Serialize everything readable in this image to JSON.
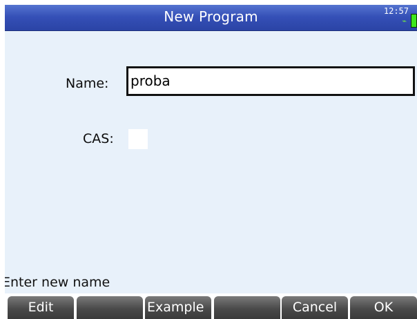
{
  "titlebar": {
    "title": "New Program",
    "clock": "12:57",
    "status_glyph": "⌁",
    "battery_color": "#3ee81c"
  },
  "form": {
    "name_label": "Name:",
    "name_value": "proba",
    "cas_label": "CAS:",
    "cas_checked": false
  },
  "help_text": "Enter new name",
  "softkeys": [
    "Edit",
    "",
    "Example",
    "",
    "Cancel",
    "OK"
  ],
  "colors": {
    "title_bar": "#3550b7",
    "screen_bg": "#e8f1fa",
    "softkey_bg": "#4a4a4a"
  }
}
